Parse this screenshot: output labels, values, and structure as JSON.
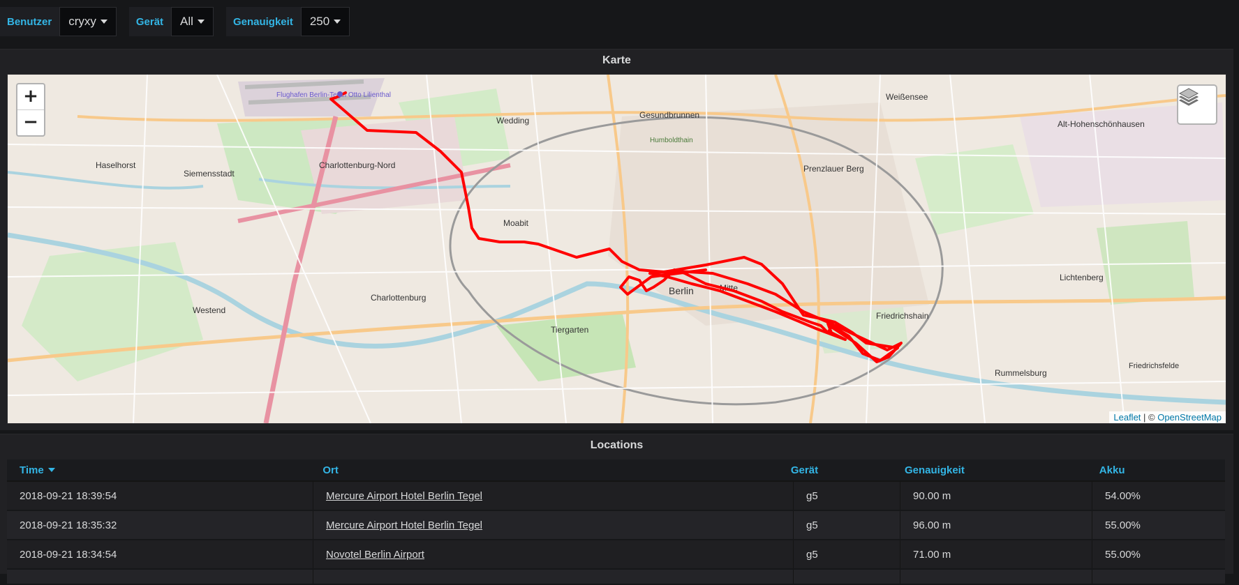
{
  "variables": [
    {
      "label": "Benutzer",
      "value": "cryxy"
    },
    {
      "label": "Gerät",
      "value": "All"
    },
    {
      "label": "Genauigkeit",
      "value": "250"
    }
  ],
  "map_panel": {
    "title": "Karte",
    "zoom_in": "+",
    "zoom_out": "−",
    "attribution": {
      "leaflet": "Leaflet",
      "separator": " | © ",
      "osm": "OpenStreetMap"
    },
    "labels": {
      "airport": "Flughafen Berlin-Tegel Otto Lilienthal",
      "wedding": "Wedding",
      "gesundbrunnen": "Gesundbrunnen",
      "weissensee": "Weißensee",
      "althohenschonhausen": "Alt-Hohenschönhausen",
      "haselhorst": "Haselhorst",
      "siemensstadt": "Siemensstadt",
      "charlottenburgnord": "Charlottenburg-Nord",
      "prenzlauerberg": "Prenzlauer Berg",
      "moabit": "Moabit",
      "charlottenburg": "Charlottenburg",
      "berlin": "Berlin",
      "mitte": "Mitte",
      "tiergarten": "Tiergarten",
      "westend": "Westend",
      "friedrichshain": "Friedrichshain",
      "lichtenberg": "Lichtenberg",
      "rummelsburg": "Rummelsburg",
      "friedrichsfelde": "Friedrichsfelde",
      "humboldthain": "Humboldthain"
    },
    "route_color": "#ff0000"
  },
  "locations_panel": {
    "title": "Locations",
    "columns": [
      "Time",
      "Ort",
      "Gerät",
      "Genauigkeit",
      "Akku"
    ],
    "rows": [
      {
        "time": "2018-09-21 18:39:54",
        "ort": "Mercure Airport Hotel Berlin Tegel",
        "geraet": "g5",
        "genauigkeit": "90.00 m",
        "akku": "54.00%"
      },
      {
        "time": "2018-09-21 18:35:32",
        "ort": "Mercure Airport Hotel Berlin Tegel",
        "geraet": "g5",
        "genauigkeit": "96.00 m",
        "akku": "55.00%"
      },
      {
        "time": "2018-09-21 18:34:54",
        "ort": "Novotel Berlin Airport",
        "geraet": "g5",
        "genauigkeit": "71.00 m",
        "akku": "55.00%"
      }
    ]
  },
  "accent_color": "#33b5e5"
}
